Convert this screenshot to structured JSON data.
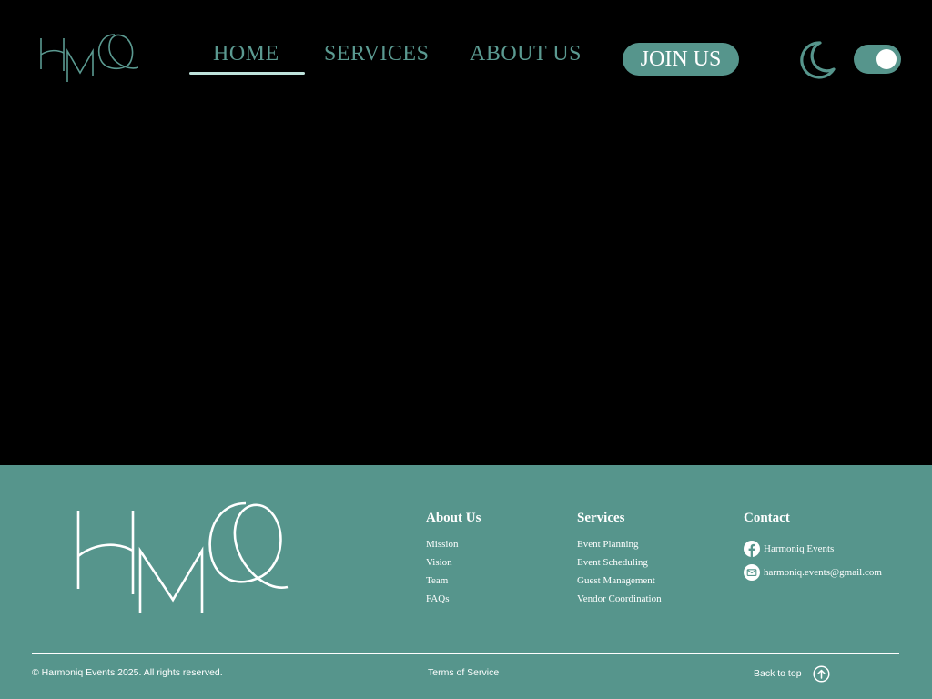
{
  "header": {
    "logo_text": "HMQ",
    "nav": {
      "home": "HOME",
      "services": "SERVICES",
      "about": "ABOUT US"
    },
    "active_nav": "home",
    "join_label": "JOIN US",
    "theme_icon": "moon-icon",
    "dark_mode_toggle": true
  },
  "footer": {
    "logo_text": "HMQ",
    "about": {
      "title": "About Us",
      "links": [
        "Mission",
        "Vision",
        "Team",
        "FAQs"
      ]
    },
    "services": {
      "title": "Services",
      "links": [
        "Event Planning",
        "Event Scheduling",
        "Guest Management",
        "Vendor Coordination"
      ]
    },
    "contact": {
      "title": "Contact",
      "facebook": "Harmoniq Events",
      "email": "harmoniq.events@gmail.com"
    },
    "copyright": "© Harmoniq Events 2025. All rights reserved.",
    "terms": "Terms of Service",
    "back_to_top": "Back to top"
  },
  "colors": {
    "background": "#000000",
    "accent": "#56958c",
    "nav_text": "#5b9a91",
    "underline": "#bfe3dc",
    "white": "#ffffff"
  }
}
